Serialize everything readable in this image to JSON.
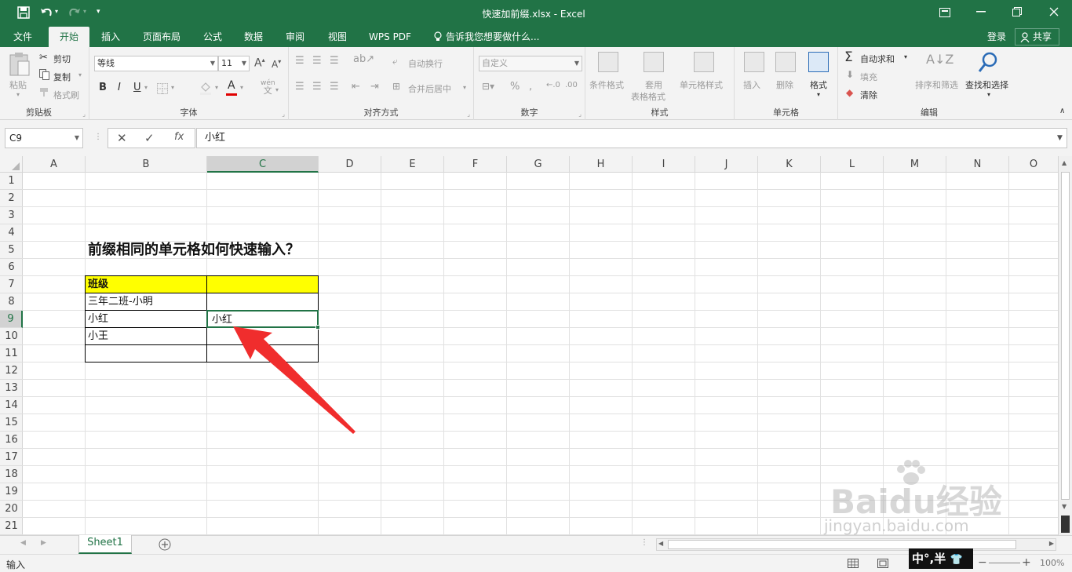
{
  "titlebar": {
    "title": "快速加前缀.xlsx  -  Excel",
    "undo_icon": "undo-icon",
    "redo_icon": "redo-icon"
  },
  "tabs": [
    "文件",
    "开始",
    "插入",
    "页面布局",
    "公式",
    "数据",
    "审阅",
    "视图",
    "WPS PDF"
  ],
  "tell_me": "告诉我您想要做什么...",
  "account": {
    "login": "登录",
    "share": "共享"
  },
  "ribbon": {
    "clipboard": {
      "paste": "粘贴",
      "cut": "剪切",
      "copy": "复制",
      "format_painter": "格式刷",
      "name": "剪贴板"
    },
    "font": {
      "family": "等线",
      "size": "11",
      "name": "字体",
      "bold": "B",
      "italic": "I",
      "underline": "U",
      "wen": "wén",
      "wen2": "文"
    },
    "alignment": {
      "wrap": "自动换行",
      "merge": "合并后居中",
      "name": "对齐方式"
    },
    "number": {
      "format": "自定义",
      "name": "数字"
    },
    "styles": {
      "cond": "条件格式",
      "table1": "套用",
      "table2": "表格格式",
      "cell": "单元格样式",
      "name": "样式"
    },
    "cells": {
      "insert": "插入",
      "delete": "删除",
      "format": "格式",
      "name": "单元格"
    },
    "editing": {
      "autosum": "自动求和",
      "fill": "填充",
      "clear": "清除",
      "sort": "排序和筛选",
      "find": "查找和选择",
      "name": "编辑"
    }
  },
  "formula_bar": {
    "name_box": "C9",
    "formula": "小红"
  },
  "columns": [
    "A",
    "B",
    "C",
    "D",
    "E",
    "F",
    "G",
    "H",
    "I",
    "J",
    "K",
    "L",
    "M",
    "N",
    "O"
  ],
  "rows": [
    "1",
    "2",
    "3",
    "4",
    "5",
    "6",
    "7",
    "8",
    "9",
    "10",
    "11",
    "12",
    "13",
    "14",
    "15",
    "16",
    "17",
    "18",
    "19",
    "20",
    "21"
  ],
  "cells": {
    "b5": "前缀相同的单元格如何快速输入？",
    "b7": "班级",
    "b8": "三年二班-小明",
    "b9": "小红",
    "b10": "小王",
    "c9": "小红"
  },
  "sheet_tab": "Sheet1",
  "status": {
    "mode": "输入",
    "zoom": "100%"
  },
  "ime": "中°,半",
  "watermark": {
    "brand": "Baidu经验",
    "url": "jingyan.baidu.com"
  },
  "colors": {
    "excel_green": "#217346",
    "header_fill": "#ffff00",
    "arrow": "#f02d2d"
  }
}
